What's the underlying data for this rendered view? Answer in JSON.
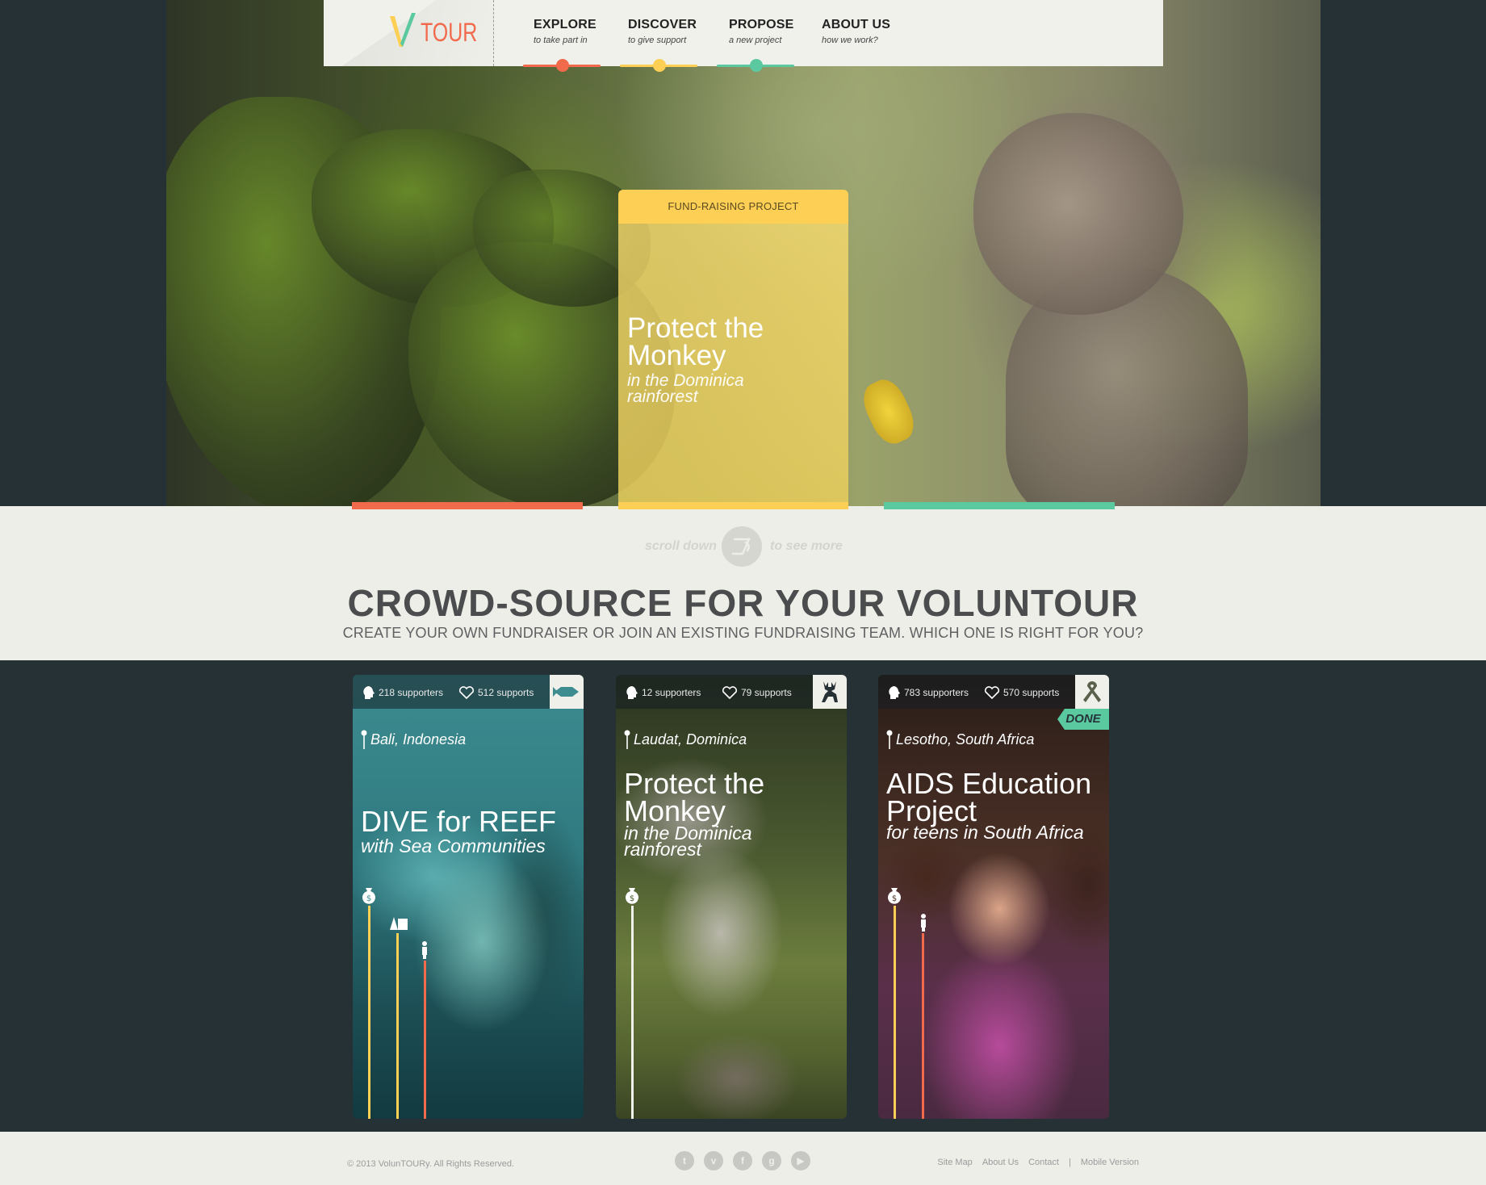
{
  "brand": {
    "name": "TOUR",
    "colors": {
      "red": "#f06a4b",
      "yellow": "#fdcf55",
      "green": "#5ac9a0",
      "dark": "#263136"
    }
  },
  "nav": [
    {
      "title": "EXPLORE",
      "sub": "to take part in",
      "color": "#f06a4b"
    },
    {
      "title": "DISCOVER",
      "sub": "to give support",
      "color": "#fdcf55"
    },
    {
      "title": "PROPOSE",
      "sub": "a new project",
      "color": "#5ac9a0"
    },
    {
      "title": "ABOUT US",
      "sub": "how we work?"
    }
  ],
  "hero": {
    "label": "FUND-RAISING PROJECT",
    "title": "Protect the Monkey",
    "sub": "in the Dominica rainforest"
  },
  "scroll": {
    "left": "scroll down",
    "right": "to see more"
  },
  "headline": "CROWD-SOURCE FOR YOUR VOLUNTOUR",
  "subheadline": "CREATE YOUR OWN FUNDRAISER OR JOIN AN EXISTING FUNDRAISING TEAM. WHICH ONE IS RIGHT FOR YOU?",
  "cards": [
    {
      "supporters": "218 supporters",
      "supports": "512 supports",
      "category_icon": "fish-icon",
      "location": "Bali, Indonesia",
      "title": "DIVE for REEF",
      "sub": "with Sea Communities"
    },
    {
      "supporters": "12 supporters",
      "supports": "79 supports",
      "category_icon": "deer-icon",
      "location": "Laudat, Dominica",
      "title": "Protect the Monkey",
      "sub": "in the Dominica rainforest"
    },
    {
      "supporters": "783 supporters",
      "supports": "570 supports",
      "category_icon": "ribbon-icon",
      "location": "Lesotho, South Africa",
      "title": "AIDS Education Project",
      "sub": "for teens in South Africa",
      "badge": "DONE"
    }
  ],
  "footer": {
    "copyright": "© 2013 VolunTOURy. All Rights Reserved.",
    "social": [
      "twitter-icon",
      "vimeo-icon",
      "facebook-icon",
      "google-plus-icon",
      "youtube-icon"
    ],
    "links": {
      "sitemap": "Site Map",
      "about": "About Us",
      "contact": "Contact",
      "separator": "|",
      "mobile": "Mobile Version"
    }
  }
}
